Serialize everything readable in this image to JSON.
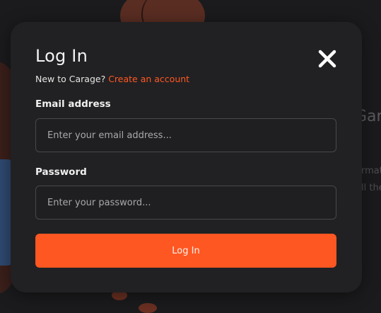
{
  "background": {
    "heading_fragment": "Gar",
    "text_line_1": "rmat",
    "text_line_2": "ll the"
  },
  "modal": {
    "title": "Log In",
    "signup_prompt": "New to Carage?",
    "signup_link": "Create an account",
    "close_icon": "close-icon",
    "email": {
      "label": "Email address",
      "placeholder": "Enter your email address...",
      "value": ""
    },
    "password": {
      "label": "Password",
      "placeholder": "Enter your password...",
      "value": ""
    },
    "submit_label": "Log In"
  },
  "colors": {
    "accent": "#ff5722",
    "modal_bg": "#212123",
    "page_bg": "#1c1c1e"
  }
}
